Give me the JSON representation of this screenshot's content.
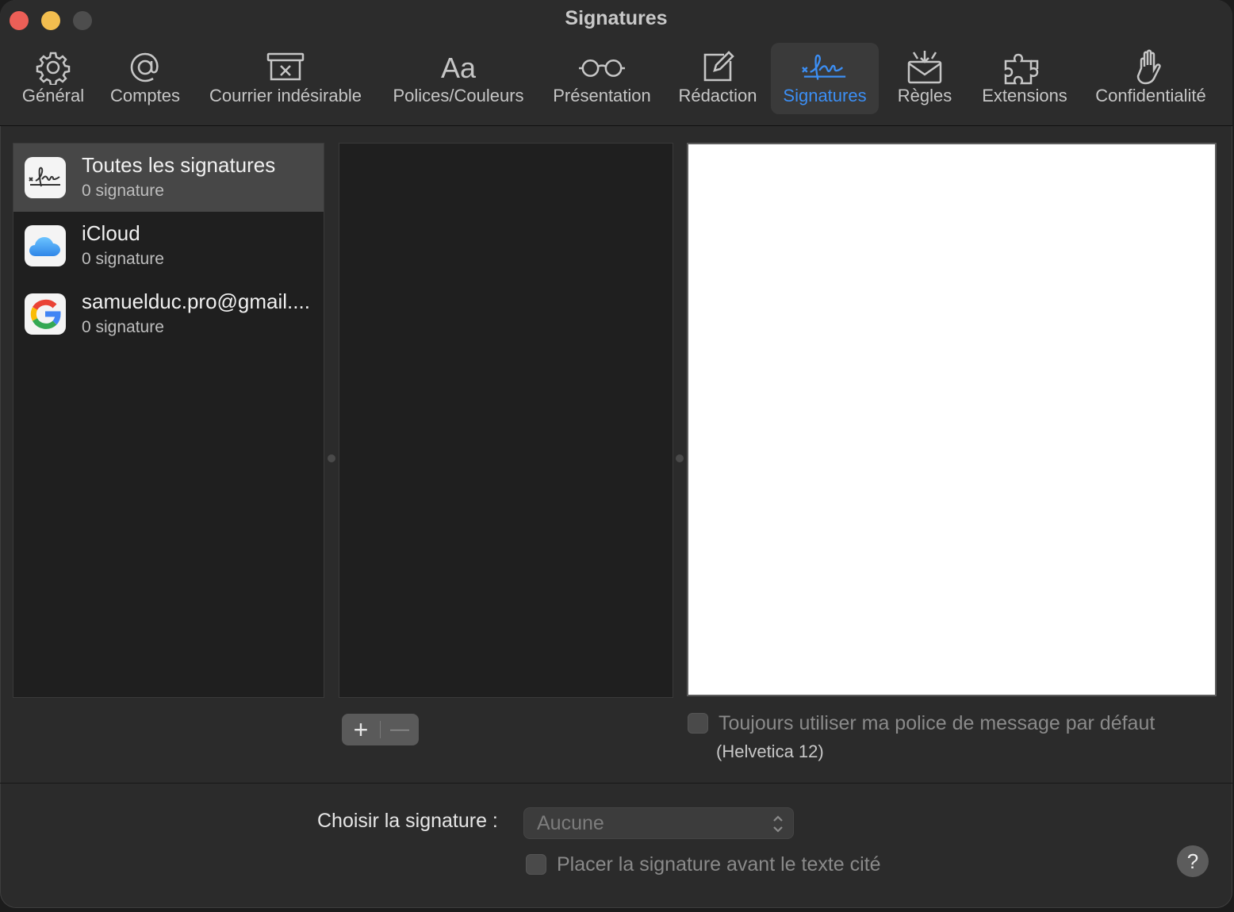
{
  "window": {
    "title": "Signatures"
  },
  "toolbar": {
    "items": [
      {
        "label": "Général",
        "icon": "gear-icon"
      },
      {
        "label": "Comptes",
        "icon": "at-icon"
      },
      {
        "label": "Courrier indésirable",
        "icon": "junk-box-icon"
      },
      {
        "label": "Polices/Couleurs",
        "icon": "fonts-icon"
      },
      {
        "label": "Présentation",
        "icon": "glasses-icon"
      },
      {
        "label": "Rédaction",
        "icon": "compose-icon"
      },
      {
        "label": "Signatures",
        "icon": "signature-icon",
        "active": true
      },
      {
        "label": "Règles",
        "icon": "rules-envelope-icon"
      },
      {
        "label": "Extensions",
        "icon": "puzzle-icon"
      },
      {
        "label": "Confidentialité",
        "icon": "hand-icon"
      }
    ],
    "accent_color": "#3c8ff5"
  },
  "accounts": [
    {
      "name": "Toutes les signatures",
      "count": "0 signature",
      "icon": "signature-app-icon",
      "selected": true
    },
    {
      "name": "iCloud",
      "count": "0 signature",
      "icon": "icloud-icon"
    },
    {
      "name": "samuelduc.pro@gmail....",
      "count": "0 signature",
      "icon": "google-icon"
    }
  ],
  "signature_list": {
    "add_label": "+",
    "remove_label": "—"
  },
  "options": {
    "default_font_label": "Toujours utiliser ma police de message par défaut",
    "default_font_value": "(Helvetica 12)",
    "choose_label": "Choisir la signature :",
    "choose_value": "Aucune",
    "place_before_label": "Placer la signature avant le texte cité"
  },
  "help": {
    "label": "?"
  }
}
